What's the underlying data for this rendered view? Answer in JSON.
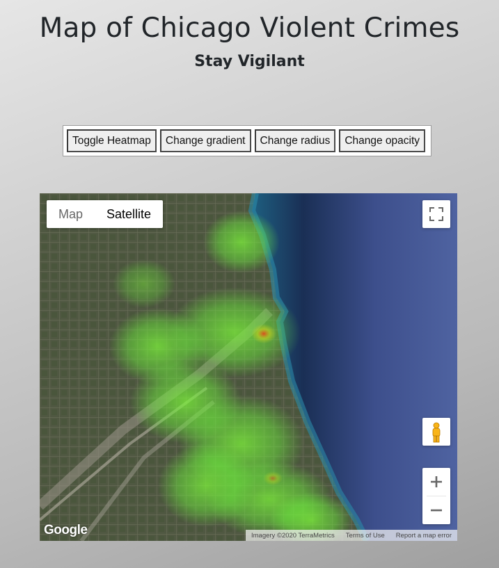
{
  "page": {
    "title": "Map of Chicago Violent Crimes",
    "subtitle": "Stay Vigilant"
  },
  "controls": {
    "buttons": [
      "Toggle Heatmap",
      "Change gradient",
      "Change radius",
      "Change opacity"
    ]
  },
  "map": {
    "map_type_options": [
      "Map",
      "Satellite"
    ],
    "selected_map_type": "Satellite",
    "logo_text": "Google",
    "footer": {
      "imagery": "Imagery ©2020 TerraMetrics",
      "terms": "Terms of Use",
      "report": "Report a map error"
    },
    "zoom_in": "+",
    "zoom_out": "−",
    "heatmap_colors": {
      "low": "#6ef23c",
      "mid": "#c8d21e",
      "high": "#e2431b"
    },
    "icons": [
      "fullscreen-icon",
      "pegman-icon",
      "zoom-in-icon",
      "zoom-out-icon"
    ]
  }
}
